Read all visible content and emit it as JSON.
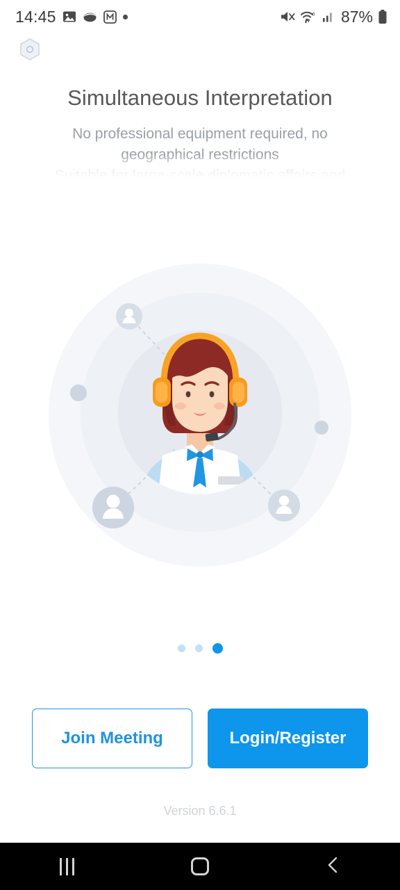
{
  "statusbar": {
    "time": "14:45",
    "left_icons": [
      "gallery-icon",
      "shell-icon",
      "m-badge-icon",
      "dot-icon"
    ],
    "right_icons": [
      "mute-icon",
      "wifi-6-icon",
      "cellular-signal-icon",
      "battery-icon"
    ],
    "battery_percent": "87%"
  },
  "logo": {
    "icon": "hexagon-target-logo"
  },
  "header": {
    "title": "Simultaneous Interpretation",
    "subtitle_line1": "No professional equipment required, no",
    "subtitle_line2": "geographical restrictions",
    "subtitle_line3": "Suitable for large-scale diplomatic affairs and"
  },
  "illustration": {
    "name": "interpreter-network-illustration",
    "center_avatar": "headset-interpreter-avatar",
    "nodes": [
      "user-avatar-top",
      "user-avatar-bottom-left",
      "user-avatar-bottom-right",
      "dot-left",
      "dot-right"
    ],
    "colors": {
      "ring": "#eef1f5",
      "ring_inner": "#e5e9ef",
      "avatar_node": "#ccd5e0",
      "headset": "#f99a1c",
      "hair": "#8e2a26",
      "skin": "#fbd9bd",
      "tie": "#2196e3",
      "shirt": "#ffffff"
    }
  },
  "pagination": {
    "total": 3,
    "active_index": 2,
    "active_color": "#0d96ec",
    "inactive_color": "#bfe0fa"
  },
  "actions": {
    "join_label": "Join Meeting",
    "login_label": "Login/Register",
    "primary_color": "#0d96ec",
    "outline_color": "#2196e3"
  },
  "footer": {
    "version": "Version 6.6.1"
  },
  "navbar": {
    "items": [
      "recents-button",
      "home-button",
      "back-button"
    ]
  }
}
